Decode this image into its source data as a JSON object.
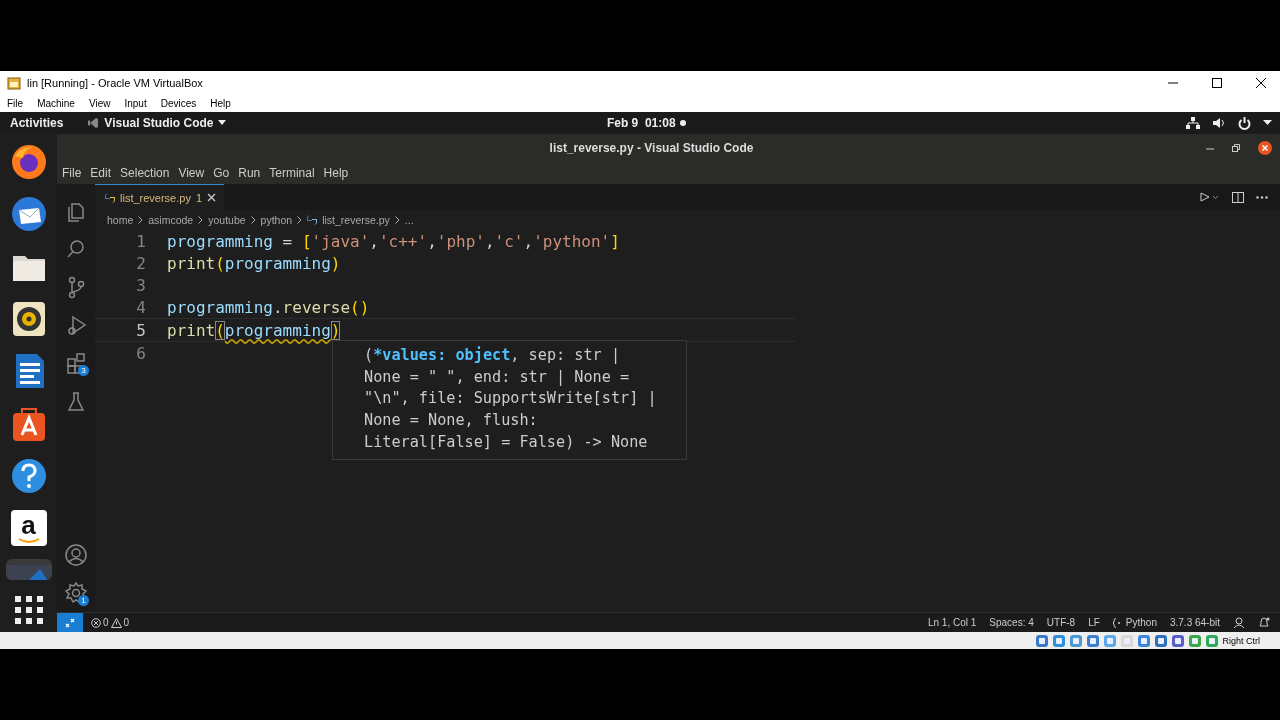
{
  "vm_window": {
    "title": "lin [Running] - Oracle VM VirtualBox",
    "menu": [
      "File",
      "Machine",
      "View",
      "Input",
      "Devices",
      "Help"
    ]
  },
  "top_bar": {
    "activities": "Activities",
    "app_menu": "Visual Studio Code",
    "clock": "Feb 9  01:08"
  },
  "dock": [
    {
      "kind": "browser",
      "selected": false
    },
    {
      "kind": "mail",
      "selected": false
    },
    {
      "kind": "folder",
      "selected": false
    },
    {
      "kind": "speaker",
      "selected": false
    },
    {
      "kind": "document",
      "selected": false
    },
    {
      "kind": "bag",
      "selected": false
    },
    {
      "kind": "help",
      "selected": false
    },
    {
      "kind": "letter",
      "glyph": "a",
      "selected": false
    },
    {
      "kind": "app",
      "selected": true
    },
    {
      "kind": "grid",
      "selected": false
    }
  ],
  "vscode": {
    "title": "list_reverse.py - Visual Studio Code",
    "menu": [
      "File",
      "Edit",
      "Selection",
      "View",
      "Go",
      "Run",
      "Terminal",
      "Help"
    ],
    "activity_bar": [
      {
        "kind": "files"
      },
      {
        "kind": "search"
      },
      {
        "kind": "source-control"
      },
      {
        "kind": "run"
      },
      {
        "kind": "extensions",
        "badge": "3"
      },
      {
        "kind": "testing"
      },
      {
        "kind": "account"
      },
      {
        "kind": "settings",
        "badge": "1"
      }
    ],
    "tabs": [
      {
        "label": "list_reverse.py",
        "problems": "1",
        "selected": true
      }
    ],
    "breadcrumbs": [
      "home",
      "asimcode",
      "youtube",
      "python",
      "list_reverse.py",
      "..."
    ],
    "code": [
      {
        "number": "1",
        "current": false,
        "tokens": [
          {
            "kind": "var",
            "text": "programming"
          },
          {
            "kind": "op",
            "text": " = "
          },
          {
            "kind": "bracket",
            "text": "["
          },
          {
            "kind": "str",
            "text": "'java'"
          },
          {
            "kind": "op",
            "text": ","
          },
          {
            "kind": "str",
            "text": "'c++'"
          },
          {
            "kind": "op",
            "text": ","
          },
          {
            "kind": "str",
            "text": "'php'"
          },
          {
            "kind": "op",
            "text": ","
          },
          {
            "kind": "str",
            "text": "'c'"
          },
          {
            "kind": "op",
            "text": ","
          },
          {
            "kind": "str",
            "text": "'python'"
          },
          {
            "kind": "bracket",
            "text": "]"
          }
        ]
      },
      {
        "number": "2",
        "current": false,
        "tokens": [
          {
            "kind": "func",
            "text": "print"
          },
          {
            "kind": "bracket",
            "text": "("
          },
          {
            "kind": "var",
            "text": "programming"
          },
          {
            "kind": "bracket",
            "text": ")"
          }
        ]
      },
      {
        "number": "3",
        "current": false
      },
      {
        "number": "4",
        "current": false,
        "tokens": [
          {
            "kind": "var",
            "text": "programming"
          },
          {
            "kind": "op",
            "text": "."
          },
          {
            "kind": "func",
            "text": "reverse"
          },
          {
            "kind": "bracket",
            "text": "()"
          }
        ]
      },
      {
        "number": "5",
        "current": true,
        "tokens": [
          {
            "kind": "func",
            "text": "print"
          },
          {
            "kind": "bracket",
            "text": "(",
            "matched": true
          },
          {
            "kind": "var",
            "text": "programming",
            "warning": true
          },
          {
            "kind": "bracket",
            "text": ")",
            "matched": true
          }
        ]
      },
      {
        "number": "6",
        "current": false
      }
    ],
    "hover": {
      "lines": [
        [
          {
            "kind": "plain",
            "text": "("
          },
          {
            "kind": "active",
            "text": "*values: object"
          },
          {
            "kind": "plain",
            "text": ", sep: str |"
          }
        ],
        [
          {
            "kind": "plain",
            "text": "None = \" \", end: str | None ="
          }
        ],
        [
          {
            "kind": "plain",
            "text": "\"\\n\", file: SupportsWrite[str] |"
          }
        ],
        [
          {
            "kind": "plain",
            "text": "None = None, flush:"
          }
        ],
        [
          {
            "kind": "plain",
            "text": "Literal[False] = False) -> None"
          }
        ]
      ]
    },
    "status_bar": {
      "errors": "0",
      "warnings": "0",
      "position": "Ln 1, Col 1",
      "indent": "Spaces: 4",
      "encoding": "UTF-8",
      "eol": "LF",
      "language": "Python",
      "interpreter": "3.7.3 64-bit"
    }
  },
  "vm_status": {
    "host_key": "Right Ctrl"
  }
}
